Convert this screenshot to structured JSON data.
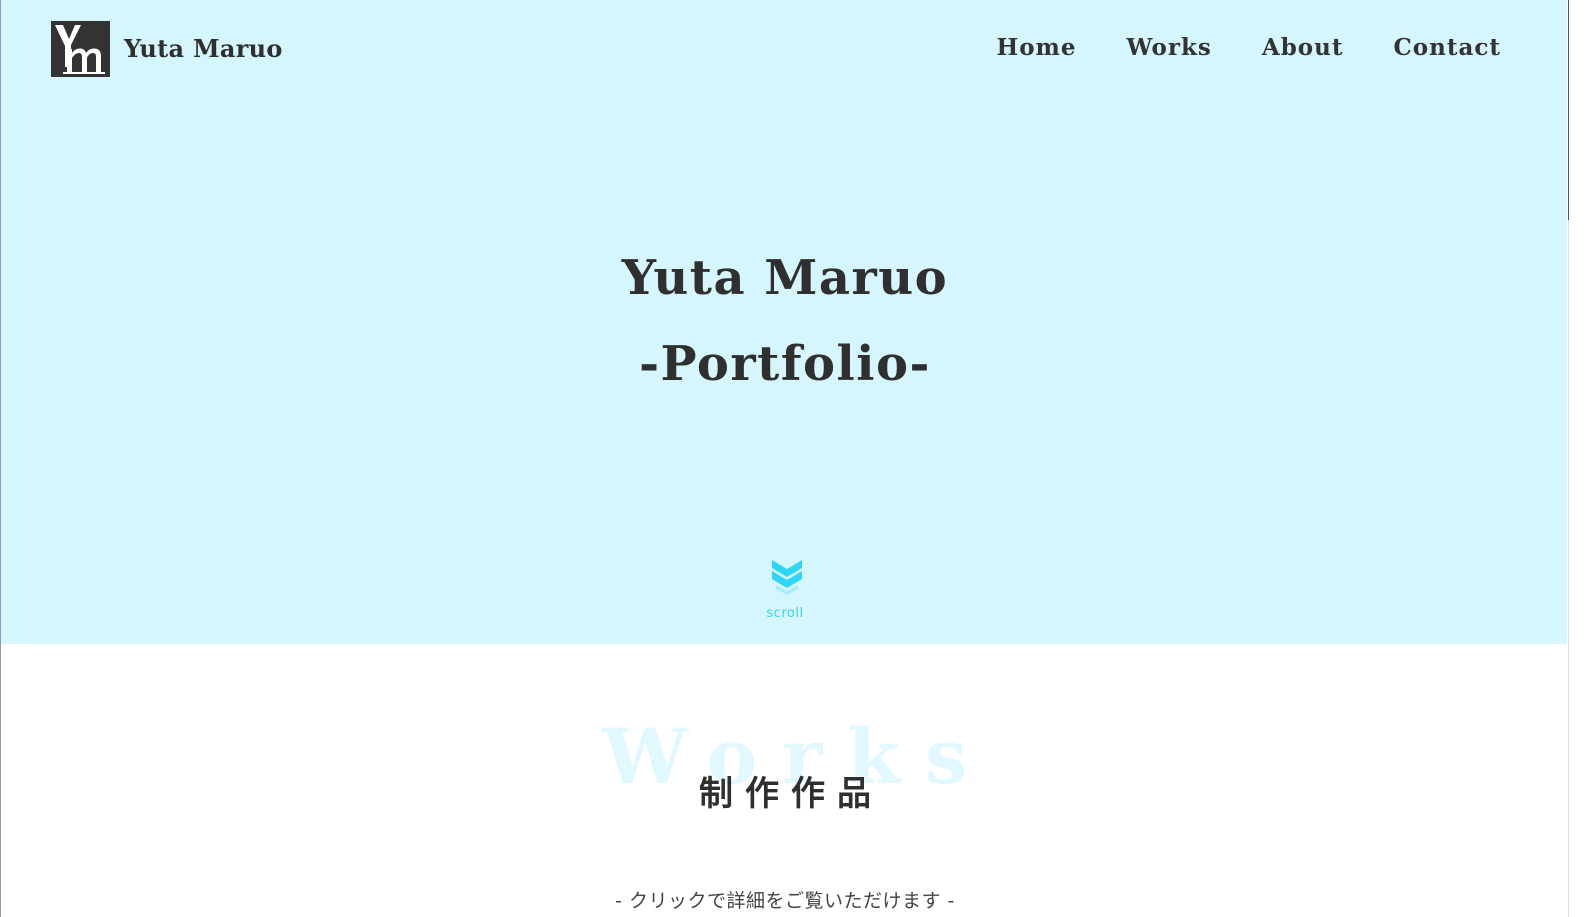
{
  "header": {
    "logo_text": "Ym",
    "site_name": "Yuta Maruo",
    "nav": [
      {
        "label": "Home"
      },
      {
        "label": "Works"
      },
      {
        "label": "About"
      },
      {
        "label": "Contact"
      }
    ]
  },
  "hero": {
    "title_line1": "Yuta Maruo",
    "title_line2": "-Portfolio-",
    "scroll_label": "scroll",
    "scroll_icon": "double-chevron-down-icon",
    "background_color": "#d5f6fd",
    "accent_color": "#2fd6f5"
  },
  "works": {
    "bg_heading": "Works",
    "heading": "制作作品",
    "note": "- クリックで詳細をご覧いただけます -"
  }
}
